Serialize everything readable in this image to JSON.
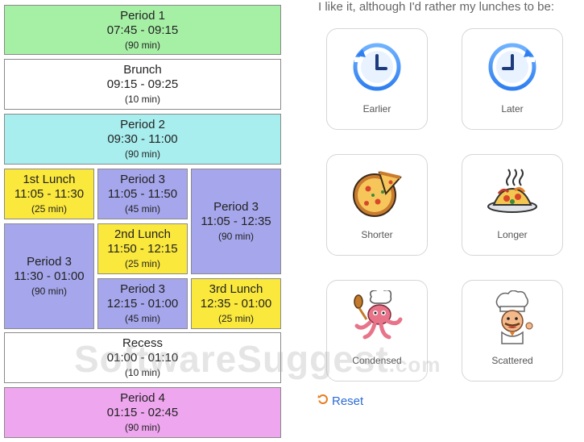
{
  "blocks": {
    "period1": {
      "name": "Period 1",
      "time": "07:45 - 09:15",
      "mins": "(90 min)"
    },
    "brunch": {
      "name": "Brunch",
      "time": "09:15 - 09:25",
      "mins": "(10 min)"
    },
    "period2": {
      "name": "Period 2",
      "time": "09:30 - 11:00",
      "mins": "(90 min)"
    },
    "lunch1": {
      "name": "1st Lunch",
      "time": "11:05 - 11:30",
      "mins": "(25 min)"
    },
    "p3a": {
      "name": "Period 3",
      "time": "11:05 - 11:50",
      "mins": "(45 min)"
    },
    "p3c": {
      "name": "Period 3",
      "time": "11:05 - 12:35",
      "mins": "(90 min)"
    },
    "p3b": {
      "name": "Period 3",
      "time": "11:30 - 01:00",
      "mins": "(90 min)"
    },
    "lunch2": {
      "name": "2nd Lunch",
      "time": "11:50 - 12:15",
      "mins": "(25 min)"
    },
    "p3d": {
      "name": "Period 3",
      "time": "12:15 - 01:00",
      "mins": "(45 min)"
    },
    "lunch3": {
      "name": "3rd Lunch",
      "time": "12:35 - 01:00",
      "mins": "(25 min)"
    },
    "recess": {
      "name": "Recess",
      "time": "01:00 - 01:10",
      "mins": "(10 min)"
    },
    "period4": {
      "name": "Period 4",
      "time": "01:15 - 02:45",
      "mins": "(90 min)"
    }
  },
  "colors": {
    "green": "#a6f0a6",
    "cyan": "#a8eeee",
    "yellow": "#fbe83c",
    "purple": "#a6a6ec",
    "pink": "#eea6ee",
    "accent": "#2c6bd6"
  },
  "feedback": {
    "question": "I like it, although I'd rather my lunches to be:",
    "options": {
      "earlier": {
        "label": "Earlier",
        "icon": "clock-rewind-icon"
      },
      "later": {
        "label": "Later",
        "icon": "clock-forward-icon"
      },
      "shorter": {
        "label": "Shorter",
        "icon": "pizza-icon"
      },
      "longer": {
        "label": "Longer",
        "icon": "pasta-plate-icon"
      },
      "condensed": {
        "label": "Condensed",
        "icon": "octopus-chef-icon"
      },
      "scattered": {
        "label": "Scattered",
        "icon": "chef-icon"
      }
    },
    "reset_label": "Reset"
  },
  "watermark": {
    "main": "SoftwareSuggest",
    "suffix": ".com"
  }
}
